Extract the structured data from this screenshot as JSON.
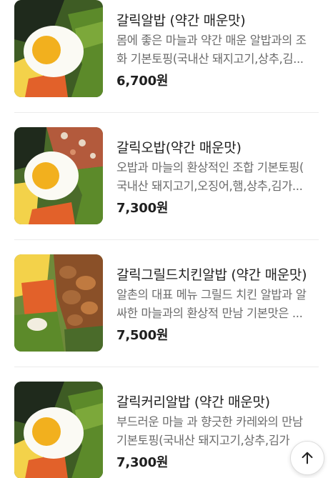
{
  "menu": {
    "items": [
      {
        "name": "갈릭알밥 (약간 매운맛)",
        "desc_line1": "몸에 좋은 마늘과 약간 매운 알밥과의 조",
        "desc_line2": "화 기본토핑(국내산 돼지고기,상추,김...",
        "price": "6,700원",
        "image": "egg-seaweed-bowl"
      },
      {
        "name": "갈릭오밥(약간 매운맛)",
        "desc_line1": "오밥과 마늘의 환상적인 조합 기본토핑(",
        "desc_line2": "국내산 돼지고기,오징어,햄,상추,김가...",
        "price": "7,300원",
        "image": "egg-ham-bowl"
      },
      {
        "name": "갈릭그릴드치킨알밥 (약간 매운맛)",
        "desc_line1": "알촌의 대표 메뉴 그릴드 치킨 알밥과 알",
        "desc_line2": "싸한 마늘과의 환상적 만남 기본맛은 ...",
        "price": "7,500원",
        "image": "grilled-chicken-bowl"
      },
      {
        "name": "갈릭커리알밥 (약간 매운맛)",
        "desc_line1": "부드러운 마늘 과 향긋한 카레와의 만남",
        "desc_line2": "기본토핑(국내산 돼지고기,상추,김가",
        "price": "7,300원",
        "image": "egg-seaweed-bowl"
      }
    ]
  },
  "scroll_top": {
    "icon": "arrow-up-icon"
  },
  "colors": {
    "egg_yolk": "#f2b01e",
    "egg_white": "#fbfaf4",
    "seaweed": "#1f2a1c",
    "lettuce": "#5c8a2a",
    "carrot": "#e2612a",
    "egg_strips": "#f3d24a",
    "ham": "#b35a3c",
    "chicken": "#a86a3a"
  }
}
